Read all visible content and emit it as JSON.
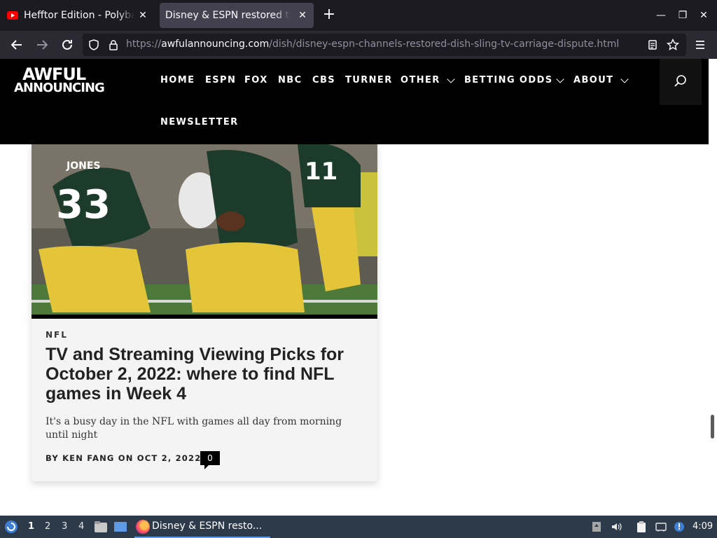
{
  "browser": {
    "tabs": [
      {
        "title": "Hefftor Edition - Polybar | Li",
        "close": "✕"
      },
      {
        "title": "Disney & ESPN restored to DISH",
        "close": "✕"
      }
    ],
    "new_tab": "+",
    "window_controls": {
      "minimize": "—",
      "restore": "❐",
      "close": "✕"
    },
    "url_prefix": "https://",
    "url_host": "awfulannouncing.com",
    "url_path": "/dish/disney-espn-channels-restored-dish-sling-tv-carriage-dispute.html"
  },
  "site": {
    "logo_line1": "AWFUL",
    "logo_line2": "ANNOUNCING",
    "menu": [
      {
        "label": "HOME"
      },
      {
        "label": "ESPN"
      },
      {
        "label": "FOX"
      },
      {
        "label": "NBC"
      },
      {
        "label": "CBS"
      },
      {
        "label": "TURNER"
      },
      {
        "label": "OTHER"
      },
      {
        "label": "BETTING ODDS"
      },
      {
        "label": "ABOUT"
      },
      {
        "label": "NEWSLETTER"
      }
    ]
  },
  "card": {
    "category": "NFL",
    "title": "TV and Streaming Viewing Picks for October 2, 2022: where to find NFL games in Week 4",
    "excerpt": "It's a busy day in the NFL with games all day from morning until night",
    "byline": "BY KEN FANG ON OCT 2, 2022",
    "comments": "0",
    "photo": {
      "jersey_left": "33",
      "name_left": "JONES",
      "jersey_right": "11"
    }
  },
  "taskbar": {
    "workspaces": [
      "1",
      "2",
      "3",
      "4"
    ],
    "active_task": "Disney & ESPN resto...",
    "clock": "4:09"
  },
  "colors": {
    "header_bg": "#000000",
    "card_bg": "#f4f4f4",
    "taskbar_bg": "#2c3a4a",
    "tab_active": "#42414d"
  }
}
